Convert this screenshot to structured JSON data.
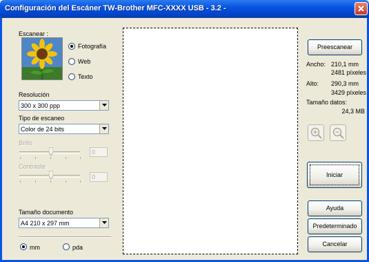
{
  "window": {
    "title": "Configuración del Escáner TW-Brother MFC-XXXX    USB - 3.2 -"
  },
  "scan": {
    "group_label": "Escanear :",
    "options": [
      {
        "label": "Fotografía",
        "selected": true
      },
      {
        "label": "Web",
        "selected": false
      },
      {
        "label": "Texto",
        "selected": false
      }
    ]
  },
  "resolution": {
    "label": "Resolución",
    "value": "300 x 300 ppp"
  },
  "scan_type": {
    "label": "Tipo de escaneo",
    "value": "Color de 24 bits"
  },
  "brightness": {
    "label": "Brillo",
    "value": "0"
  },
  "contrast": {
    "label": "Contraste",
    "value": "0"
  },
  "doc_size": {
    "label": "Tamaño documento",
    "value": "A4 210 x 297 mm"
  },
  "units": {
    "mm": {
      "label": "mm",
      "selected": true
    },
    "inch": {
      "label": "pda",
      "selected": false
    }
  },
  "actions": {
    "prescan": "Preescanear",
    "start": "Iniciar",
    "help": "Ayuda",
    "default": "Predeterminado",
    "cancel": "Cancelar"
  },
  "info": {
    "width_label": "Ancho:",
    "width_mm": "210,1 mm",
    "width_px": "2481 píxeles",
    "height_label": "Alto:",
    "height_mm": "290,3 mm",
    "height_px": "3429 píxeles",
    "data_size_label": "Tamaño datos:",
    "data_size_value": "24,3 MB"
  },
  "icons": {
    "zoom_in": "zoom-in-icon",
    "zoom_out": "zoom-out-icon",
    "close": "close-icon"
  },
  "colors": {
    "title_bar": "#0a54e0",
    "window_bg": "#ece9d8",
    "close_button": "#c6391c"
  }
}
